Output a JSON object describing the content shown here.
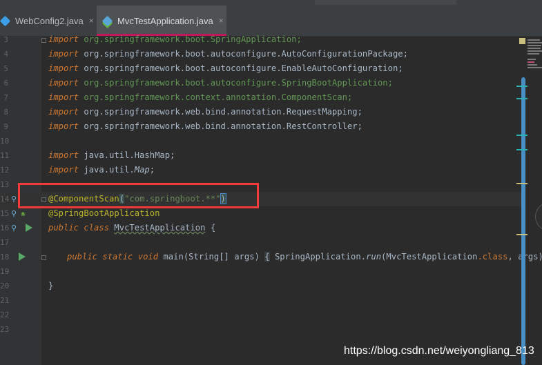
{
  "tabs": [
    {
      "label": "WebConfig2.java",
      "close": "×",
      "icon": "java-file-icon"
    },
    {
      "label": "MvcTestApplication.java",
      "close": "×",
      "icon": "java-spring-file-icon"
    }
  ],
  "lines": [
    {
      "num": "3"
    },
    {
      "num": "4"
    },
    {
      "num": "5"
    },
    {
      "num": "6"
    },
    {
      "num": "7"
    },
    {
      "num": "8"
    },
    {
      "num": "9"
    },
    {
      "num": "10"
    },
    {
      "num": "11"
    },
    {
      "num": "12"
    },
    {
      "num": "13"
    },
    {
      "num": "14"
    },
    {
      "num": "15"
    },
    {
      "num": "16"
    },
    {
      "num": "17"
    },
    {
      "num": "18"
    },
    {
      "num": "19"
    },
    {
      "num": "20"
    },
    {
      "num": "21"
    },
    {
      "num": "22"
    },
    {
      "num": "23"
    }
  ],
  "code": {
    "import": "import",
    "l3_pkg": "org.springframework.boot.SpringApplication;",
    "l4_pkg": "org.springframework.boot.autoconfigure.AutoConfigurationPackage;",
    "l5_pkg": "org.springframework.boot.autoconfigure.EnableAutoConfiguration;",
    "l6_pkg": "org.springframework.boot.autoconfigure.SpringBootApplication;",
    "l7_pkg": "org.springframework.context.annotation.ComponentScan;",
    "l8_pkg": "org.springframework.web.bind.annotation.RequestMapping;",
    "l9_pkg": "org.springframework.web.bind.annotation.RestController;",
    "l11_pkg": "java.util.HashMap;",
    "l12_pre": "java.util.",
    "l12_map": "Map",
    "l12_post": ";",
    "l14_ann": "@ComponentScan",
    "l14_open": "(",
    "l14_str": "\"com.springboot.**\"",
    "l14_close": ")",
    "l15_ann": "@SpringBootApplication",
    "l16_public": "public",
    "l16_class": "class",
    "l16_name": "MvcTestApplication",
    "l16_brace": " {",
    "l18_public": "public",
    "l18_static": "static",
    "l18_void": "void",
    "l18_main": "main",
    "l18_args_open": "(",
    "l18_string": "String",
    "l18_arr": "[] ",
    "l18_args": "args",
    "l18_args_close": ")",
    "l18_lbrace": "{",
    "l18_sa": "SpringApplication",
    "l18_dot": ".",
    "l18_run": "run",
    "l18_rparen_open": "(",
    "l18_cls": "MvcTestApplication",
    "l18_classkw": ".class",
    "l18_comma": ", ",
    "l18_args2": "args",
    "l18_end": ");",
    "l20_brace": "}"
  },
  "watermark": "https://blog.csdn.net/weiyongliang_813",
  "colors": {
    "keyword": "#cc7832",
    "annotation": "#bbb529",
    "string": "#6a8759",
    "method": "#ffc66d",
    "highlight_box": "#f23b3b",
    "active_tab_underline": "#c2185b"
  }
}
